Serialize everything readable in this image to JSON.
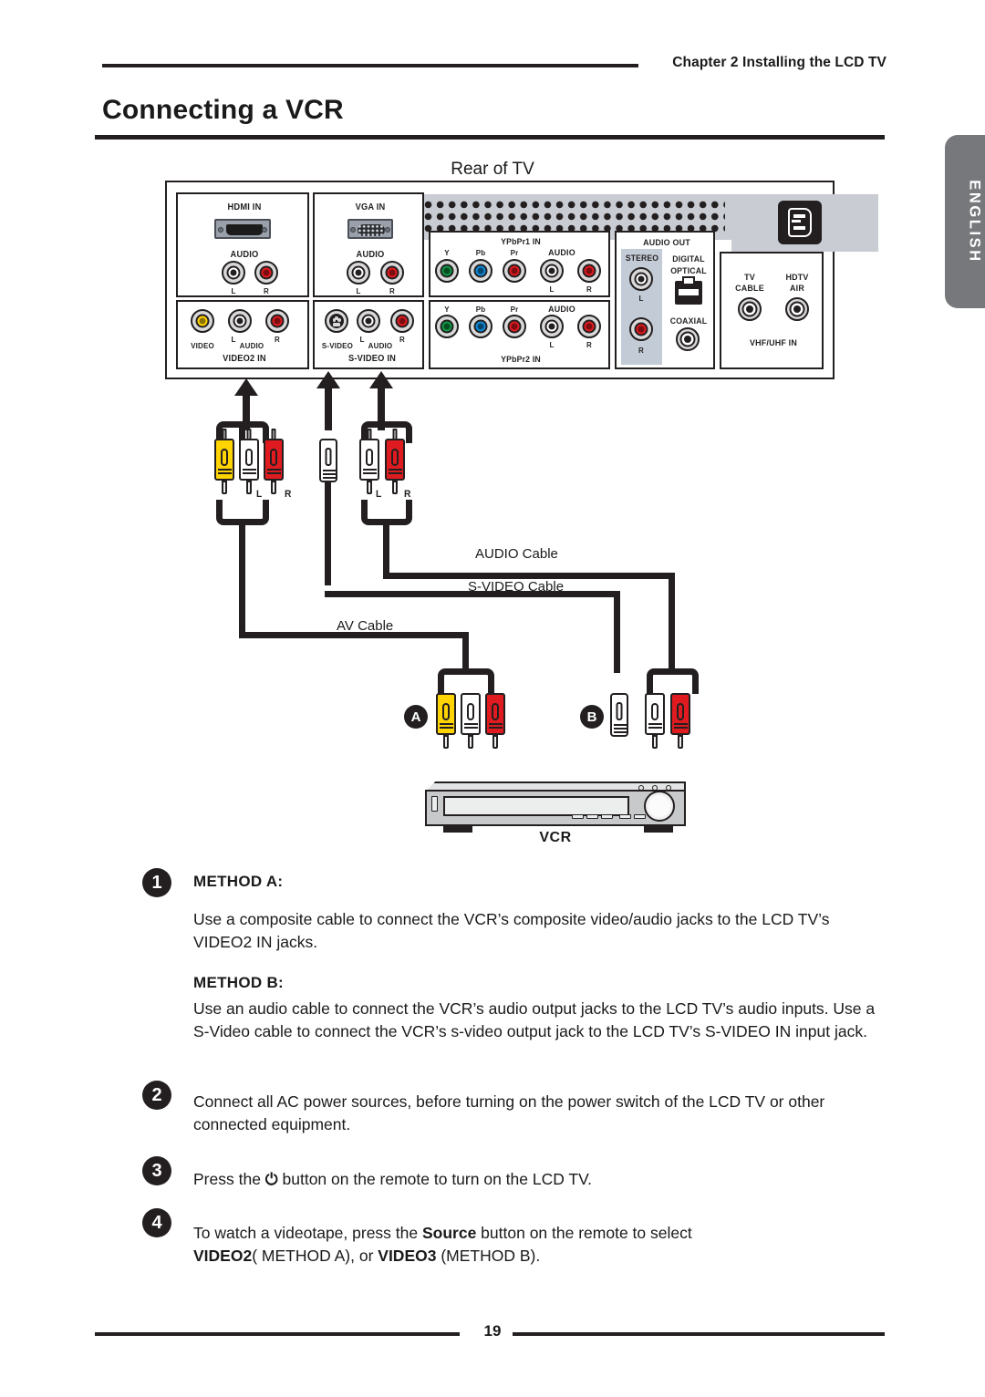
{
  "header": {
    "chapter": "Chapter 2 Installing the LCD TV",
    "title": "Connecting a VCR",
    "side_tab": "ENGLISH"
  },
  "diagram": {
    "rear_caption": "Rear of TV",
    "tv_panel": {
      "hdmi": {
        "title": "HDMI IN",
        "audio": "AUDIO",
        "left": "L",
        "right": "R"
      },
      "vga": {
        "title": "VGA IN",
        "audio": "AUDIO",
        "left": "L",
        "right": "R"
      },
      "video2": {
        "title": "VIDEO2 IN",
        "video": "VIDEO",
        "audio": "AUDIO",
        "left": "L",
        "right": "R"
      },
      "svideo": {
        "title": "S-VIDEO IN",
        "svideo": "S-VIDEO",
        "audio": "AUDIO",
        "left": "L",
        "right": "R"
      },
      "ypbpr1": {
        "title": "YPbPr1 IN",
        "y": "Y",
        "pb": "Pb",
        "pr": "Pr",
        "audio": "AUDIO",
        "left": "L",
        "right": "R"
      },
      "ypbpr2": {
        "title": "YPbPr2 IN",
        "y": "Y",
        "pb": "Pb",
        "pr": "Pr",
        "audio": "AUDIO",
        "left": "L",
        "right": "R"
      },
      "audio_out": {
        "title": "AUDIO OUT",
        "stereo": "STEREO",
        "stereo_left": "L",
        "stereo_right": "R",
        "digital": "DIGITAL",
        "optical": "OPTICAL",
        "coaxial": "COAXIAL"
      },
      "antenna": {
        "tv": "TV",
        "cable": "CABLE",
        "hdtv": "HDTV",
        "air": "AIR",
        "title": "VHF/UHF IN"
      }
    },
    "cable_labels": {
      "audio": "AUDIO Cable",
      "svideo": "S-VIDEO Cable",
      "av": "AV Cable"
    },
    "plug_labels": {
      "left": "L",
      "right": "R"
    },
    "badges": {
      "a": "A",
      "b": "B"
    },
    "device_caption": "VCR"
  },
  "steps": [
    {
      "number": "1",
      "method_a_head": "METHOD A:",
      "method_a_text": "Use a composite cable to connect the VCR’s composite video/audio jacks to the LCD TV’s VIDEO2 IN jacks.",
      "method_b_head": "METHOD B:",
      "method_b_text": "Use an audio cable to connect the VCR’s audio output jacks to the LCD TV’s audio inputs. Use a S-Video cable to connect the VCR’s s-video output jack to the LCD TV’s S-VIDEO IN input jack."
    },
    {
      "number": "2",
      "text": "Connect all AC power sources, before turning on the power switch of the LCD TV or other connected equipment."
    },
    {
      "number": "3",
      "text_before": "Press the ",
      "power_icon": "⏻",
      "text_after": " button on the remote to turn on the LCD TV."
    },
    {
      "number": "4",
      "line1_before": "To watch a videotape, press the ",
      "line1_bold": "Source",
      "line1_after": " button on the remote to select",
      "line2_bold1": "VIDEO2",
      "line2_mid": "( METHOD A), or ",
      "line2_bold2": "VIDEO3",
      "line2_end": " (METHOD B)."
    }
  ],
  "footer": {
    "page_number": "19"
  }
}
